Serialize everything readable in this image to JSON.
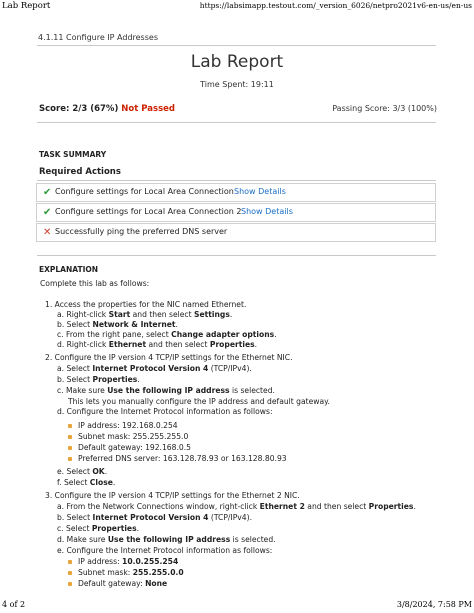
{
  "browser": {
    "page_title": "Lab Report",
    "url": "https://labsimapp.testout.com/_version_6026/netpro2021v6-en-us/en-us",
    "page_number": "4 of 2",
    "datetime": "3/8/2024, 7:58 PM"
  },
  "report": {
    "breadcrumb": "4.1.11 Configure IP Addresses",
    "title": "Lab Report",
    "time_spent": "Time Spent: 19:11",
    "score_label": "Score: 2/3 (67%)",
    "status": "Not Passed",
    "passing_score": "Passing Score: 3/3 (100%)"
  },
  "task_summary": {
    "heading": "TASK SUMMARY",
    "required_heading": "Required Actions",
    "actions": [
      {
        "icon": "check-icon",
        "label": "Configure settings for Local Area Connection",
        "link": "Show Details",
        "passed": true
      },
      {
        "icon": "check-icon",
        "label": "Configure settings for Local Area Connection 2",
        "link": "Show Details",
        "passed": true
      },
      {
        "icon": "cross-icon",
        "label": "Successfully ping the preferred DNS server",
        "link": "",
        "passed": false
      }
    ]
  },
  "explanation": {
    "heading": "EXPLANATION",
    "intro": "Complete this lab as follows:",
    "s1": "1. Access the properties for the NIC named Ethernet.",
    "s1a_pre": "a. Right-click ",
    "s1a_b1": "Start",
    "s1a_mid": " and then select ",
    "s1a_b2": "Settings",
    "s1a_end": ".",
    "s1b_pre": "b. Select ",
    "s1b_b": "Network & Internet",
    "s1b_end": ".",
    "s1c_pre": "c. From the right pane, select ",
    "s1c_b": "Change adapter options",
    "s1c_end": ".",
    "s1d_pre": "d. Right-click ",
    "s1d_b1": "Ethernet",
    "s1d_mid": " and then select ",
    "s1d_b2": "Properties",
    "s1d_end": ".",
    "s2": "2. Configure the IP version 4 TCP/IP settings for the Ethernet NIC.",
    "s2a_pre": "a. Select ",
    "s2a_b": "Internet Protocol Version 4",
    "s2a_end": " (TCP/IPv4).",
    "s2b_pre": "b. Select ",
    "s2b_b": "Properties",
    "s2b_end": ".",
    "s2c_pre": "c. Make sure ",
    "s2c_b": "Use the following IP address",
    "s2c_end": " is selected.",
    "s2c_note": "This lets you manually configure the IP address and default gateway.",
    "s2d": "d. Configure the Internet Protocol information as follows:",
    "s2_ip_pre": "IP address: ",
    "s2_ip": "192.168.0.254",
    "s2_mask_pre": "Subnet mask: ",
    "s2_mask": "255.255.255.0",
    "s2_gw_pre": "Default gateway: ",
    "s2_gw": "192.168.0.5",
    "s2_dns_pre": "Preferred DNS server: ",
    "s2_dns": "163.128.78.93 or 163.128.80.93",
    "s2e_pre": "e. Select ",
    "s2e_b": "OK",
    "s2e_end": ".",
    "s2f_pre": "f. Select ",
    "s2f_b": "Close",
    "s2f_end": ".",
    "s3": "3. Configure the IP version 4 TCP/IP settings for the Ethernet 2 NIC.",
    "s3a_pre": "a. From the Network Connections window, right-click ",
    "s3a_b1": "Ethernet 2",
    "s3a_mid": " and then select ",
    "s3a_b2": "Properties",
    "s3a_end": ".",
    "s3b_pre": "b. Select ",
    "s3b_b": "Internet Protocol Version 4",
    "s3b_end": " (TCP/IPv4).",
    "s3c_pre": "c. Select ",
    "s3c_b": "Properties",
    "s3c_end": ".",
    "s3d_pre": "d. Make sure ",
    "s3d_b": "Use the following IP address",
    "s3d_end": " is selected.",
    "s3e": "e. Configure the Internet Protocol information as follows:",
    "s3_ip_pre": "IP address: ",
    "s3_ip": "10.0.255.254",
    "s3_mask_pre": "Subnet mask: ",
    "s3_mask": "255.255.0.0",
    "s3_gw_pre": "Default gateway: ",
    "s3_gw": "None"
  },
  "colors": {
    "fail": "#cc2200",
    "pass_icon": "#2e9b3a",
    "fail_icon": "#d03b2a",
    "link": "#1a6fc4",
    "bullet": "#e8a33b"
  }
}
